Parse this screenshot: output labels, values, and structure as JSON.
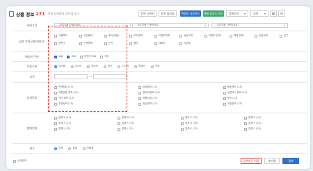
{
  "header": {
    "title": "상품 정보",
    "count": "271",
    "subtitle": "전체 검색결과 조회 합니다.",
    "buttons": [
      "정렬 기록된",
      "정렬 불러옴",
      "엑셀로 다운로드",
      "엑셀 업로드 하기"
    ],
    "select": "정렬순서",
    "select2": "검색"
  },
  "rows": {
    "category": {
      "label": "카테고리",
      "dd": [
        "-- 대분류를 선택하세요 --",
        "-- 중분류를 선택하세요 --",
        "-- 소분류를 선택하세요 --"
      ]
    },
    "service": {
      "label": "상품 조회구분(대분류)",
      "items": [
        "사용목적",
        "사은품목",
        "회사(대중)",
        "모두판매",
        "이벤트판매",
        "공동구매",
        "이벤트 판매",
        "제품 판매",
        "공동판매",
        "공구",
        "공동구",
        "선택판매",
        "인기",
        "할인",
        "새로운",
        "사은품"
      ]
    },
    "extra": {
      "label": "배송비 구분",
      "items": [
        "유료",
        "무료",
        "조건부 무료",
        "기타"
      ]
    },
    "usage": {
      "label": "이용구분",
      "items": [
        "유아동",
        "주니어",
        "청소년",
        "성인",
        "시니어",
        "중장년",
        "전체"
      ]
    },
    "price": {
      "label": "가격"
    },
    "detail": {
      "label": "상세정보",
      "items": [
        "판매정보 (23)",
        "상세정보 (13)",
        "배송정보 (13)",
        "교환반품 정보 (13)",
        "판매자정보 (13)",
        "상품고시 정보 (13)",
        "기타 정보 (13)",
        "상품리뷰 (13)",
        "문의 (13)",
        "주문정보 (13)",
        "정산정보 (13)",
        "쿠폰정보 (13)"
      ]
    },
    "seller": {
      "label": "판매업체",
      "items": [
        "업체 A (23)",
        "업체 B (13)",
        "업체 C (13)",
        "업체 D (13)",
        "업체 E (13)",
        "업체 F (13)",
        "업체 G (13)",
        "업체 H (13)",
        "업체 I (13)",
        "업체 J (13)",
        "업체 K (13)",
        "업체 L (13)"
      ]
    },
    "stock": {
      "label": "재고",
      "items": [
        "전체",
        "품절",
        "판매중"
      ]
    }
  },
  "footer": {
    "toggle": "상세검색",
    "b1": "검색조건 저장",
    "b2": "초기화",
    "b3": "검색"
  }
}
